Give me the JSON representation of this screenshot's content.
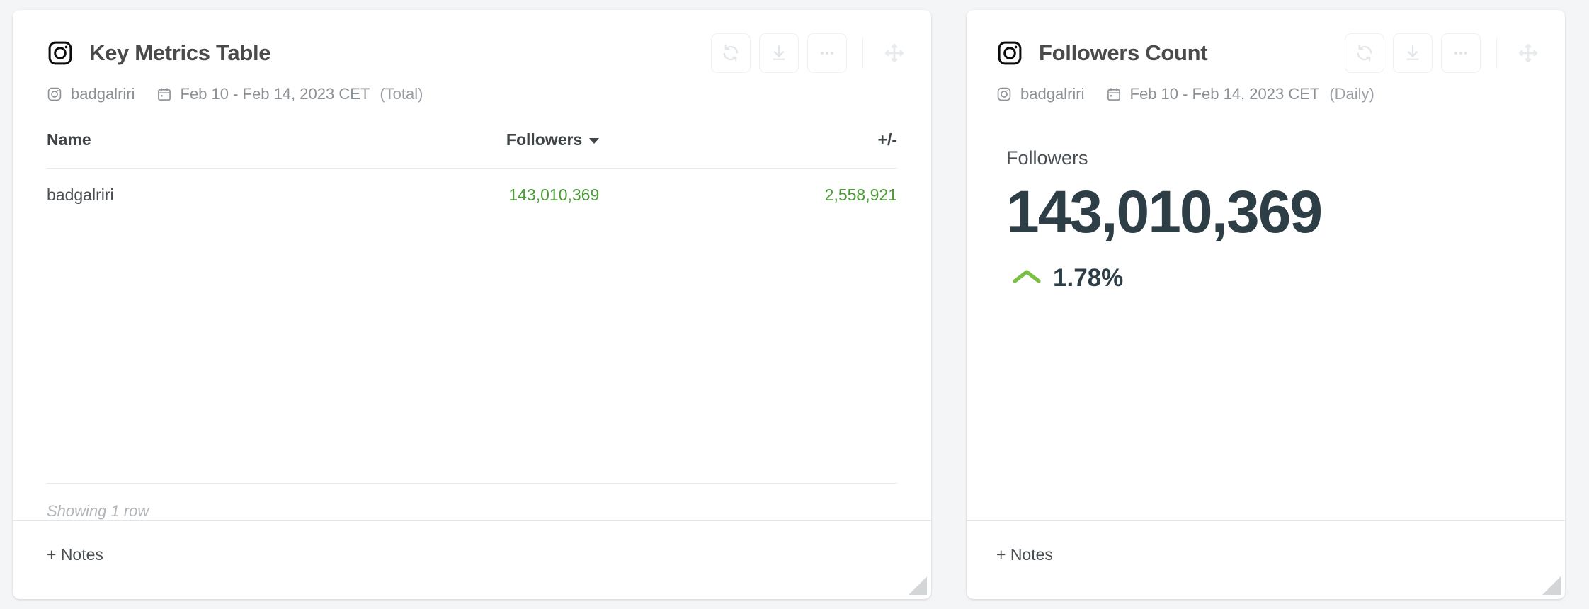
{
  "theme": {
    "page_background": "#f4f5f7",
    "card_background": "#ffffff",
    "title_color": "#4a4a4a",
    "muted_color": "#8c9196",
    "positive_color": "#4a9e35",
    "metric_color": "#2d3e46",
    "accent_green": "#7ac143"
  },
  "cards": [
    {
      "icon": "instagram-icon",
      "title": "Key Metrics Table",
      "account": "badgalriri",
      "account_icon": "instagram-icon",
      "date_icon": "calendar-icon",
      "date_range": "Feb 10 - Feb 14, 2023 CET",
      "aggregation": "(Total)",
      "toolbar": {
        "refresh_label": "Refresh",
        "download_label": "Download",
        "more_label": "More options",
        "move_label": "Move widget"
      },
      "table": {
        "columns": [
          "Name",
          "Followers",
          "+/-"
        ],
        "sorted_column": "Followers",
        "sort_direction": "desc",
        "rows": [
          {
            "name": "badgalriri",
            "followers": "143,010,369",
            "delta": "2,558,921"
          }
        ],
        "footer": "Showing 1 row"
      },
      "notes_label": "+ Notes"
    },
    {
      "icon": "instagram-icon",
      "title": "Followers Count",
      "account": "badgalriri",
      "account_icon": "instagram-icon",
      "date_icon": "calendar-icon",
      "date_range": "Feb 10 - Feb 14, 2023 CET",
      "aggregation": "(Daily)",
      "toolbar": {
        "refresh_label": "Refresh",
        "download_label": "Download",
        "more_label": "More options",
        "move_label": "Move widget"
      },
      "metric": {
        "label": "Followers",
        "value": "143,010,369",
        "change": "1.78%",
        "change_direction": "up"
      },
      "notes_label": "+ Notes"
    }
  ]
}
